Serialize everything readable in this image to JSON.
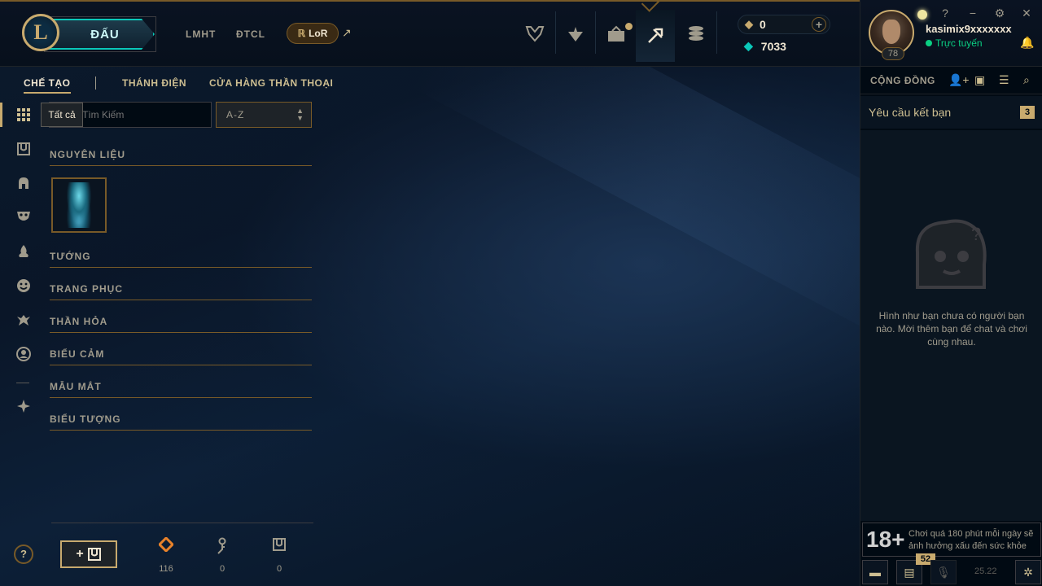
{
  "topnav": {
    "play_label": "ĐẤU",
    "logo_letter": "L",
    "links": [
      "LMHT",
      "ĐTCL"
    ],
    "lor_label": "LoR",
    "lor_arrow": "↗",
    "icons": [
      "trophy-icon",
      "ranked-icon",
      "collection-icon",
      "loot-icon",
      "store-icon"
    ]
  },
  "currency": {
    "rp": "0",
    "be": "7033"
  },
  "profile": {
    "username": "kasimix9xxxxxxx",
    "status": "Trực tuyến",
    "level": "78"
  },
  "window": {
    "help": "?",
    "minimize": "−",
    "settings": "⚙",
    "close": "✕"
  },
  "loot": {
    "tabs": [
      "CHẾ TẠO",
      "THÁNH ĐIỆN",
      "CỬA HÀNG THẦN THOẠI"
    ],
    "tooltip": "Tất cả",
    "search_placeholder": "Tìm Kiếm",
    "sort_value": "A-Z",
    "sections": [
      "NGUYÊN LIỆU",
      "TƯỚNG",
      "TRANG PHỤC",
      "THẦN HỎA",
      "BIỂU CẢM",
      "MẪU MẮT",
      "BIỂU TƯỢNG"
    ],
    "craft_label": "+",
    "counters": [
      {
        "icon": "orange-essence-icon",
        "value": "116",
        "color": "#e8822a"
      },
      {
        "icon": "key-fragment-icon",
        "value": "0",
        "color": "#a09b8c"
      },
      {
        "icon": "chest-icon",
        "value": "0",
        "color": "#a09b8c"
      }
    ],
    "help": "?"
  },
  "social": {
    "title": "CỘNG ĐỒNG",
    "friend_requests_label": "Yêu cầu kết bạn",
    "friend_requests_count": "3",
    "empty_text": "Hình như bạn chưa có người bạn nào. Mời thêm bạn để chat và chơi cùng nhau.",
    "age_label": "18+",
    "warning": "Chơi quá 180 phút mỗi ngày sẽ ảnh hưởng xấu đến sức khỏe",
    "notif_count": "52",
    "version": "25.22"
  },
  "colors": {
    "gold": "#c8aa6e",
    "teal": "#0ac8b9",
    "online": "#0acf83"
  }
}
